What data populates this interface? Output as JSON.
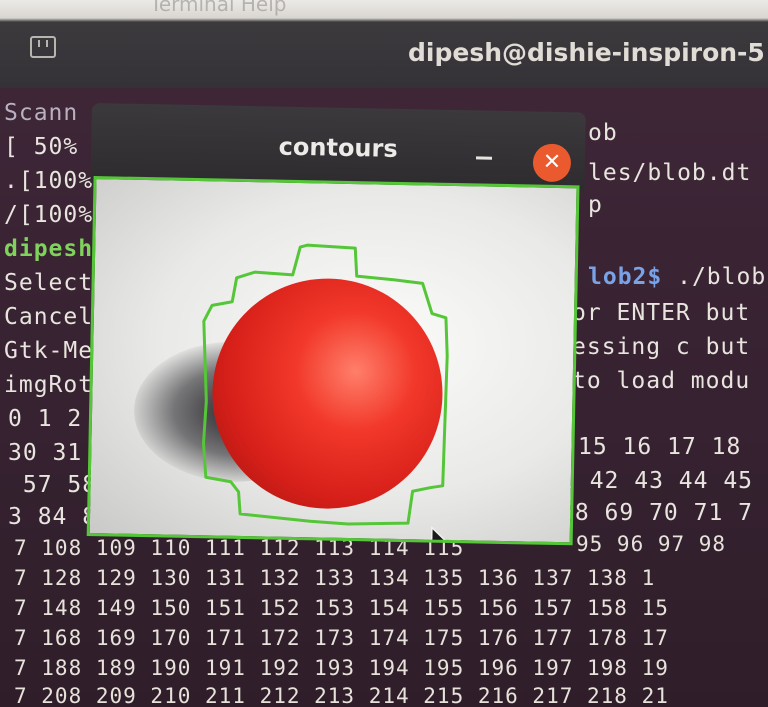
{
  "background_window": {
    "title": "dipesh@dishie-inspiron-5",
    "menu_partial": "Terminal  Help"
  },
  "terminal_lines": {
    "l1": "Scann",
    "l1b": "ob",
    "l2": "[ 50%",
    "l3": ".[100%",
    "l3b": "les/blob.dt",
    "l4": "/[100%",
    "l4b": "p",
    "l5_prompt": "dipesh",
    "l5b_prompt": "lob2$",
    "l5b_cmd": " ./blob",
    "l6": "Select",
    "l7": "Cancel",
    "l7b": "or ENTER but",
    "l8": "Gtk-Me",
    "l8b": "essing c but",
    "l9": "imgRot",
    "l9b": "to load modu",
    "l10": "0 1 2",
    "l11": "30 31",
    "l11b": "15 16 17 18",
    "l12": " 57 58",
    "l12b": "1 42 43 44 45",
    "l13": "3 84 8",
    "l13b": "58 69 70 71 7",
    "l14a": "7 108 109 110 111 112 113 114 115",
    "l14b": "95 96 97 98",
    "l15": "7 128 129 130 131 132 133 134 135 136 137 138 1",
    "l16": "7 148 149 150 151 152 153 154 155 156 157 158 15",
    "l17": "7 168 169 170 171 172 173 174 175 176 177 178 17",
    "l18": "7 188 189 190 191 192 193 194 195 196 197 198 19",
    "l19": "7 208 209 210 211 212 213 214 215 216 217 218 21"
  },
  "contours_window": {
    "title": "contours",
    "minimize_symbol": "–",
    "close_symbol": "✕"
  },
  "colors": {
    "contour_green": "#55c638",
    "close_button": "#ea5a2e",
    "ball_red": "#e0261d",
    "prompt_green": "#7fd35d",
    "path_blue": "#7aa2e6"
  }
}
